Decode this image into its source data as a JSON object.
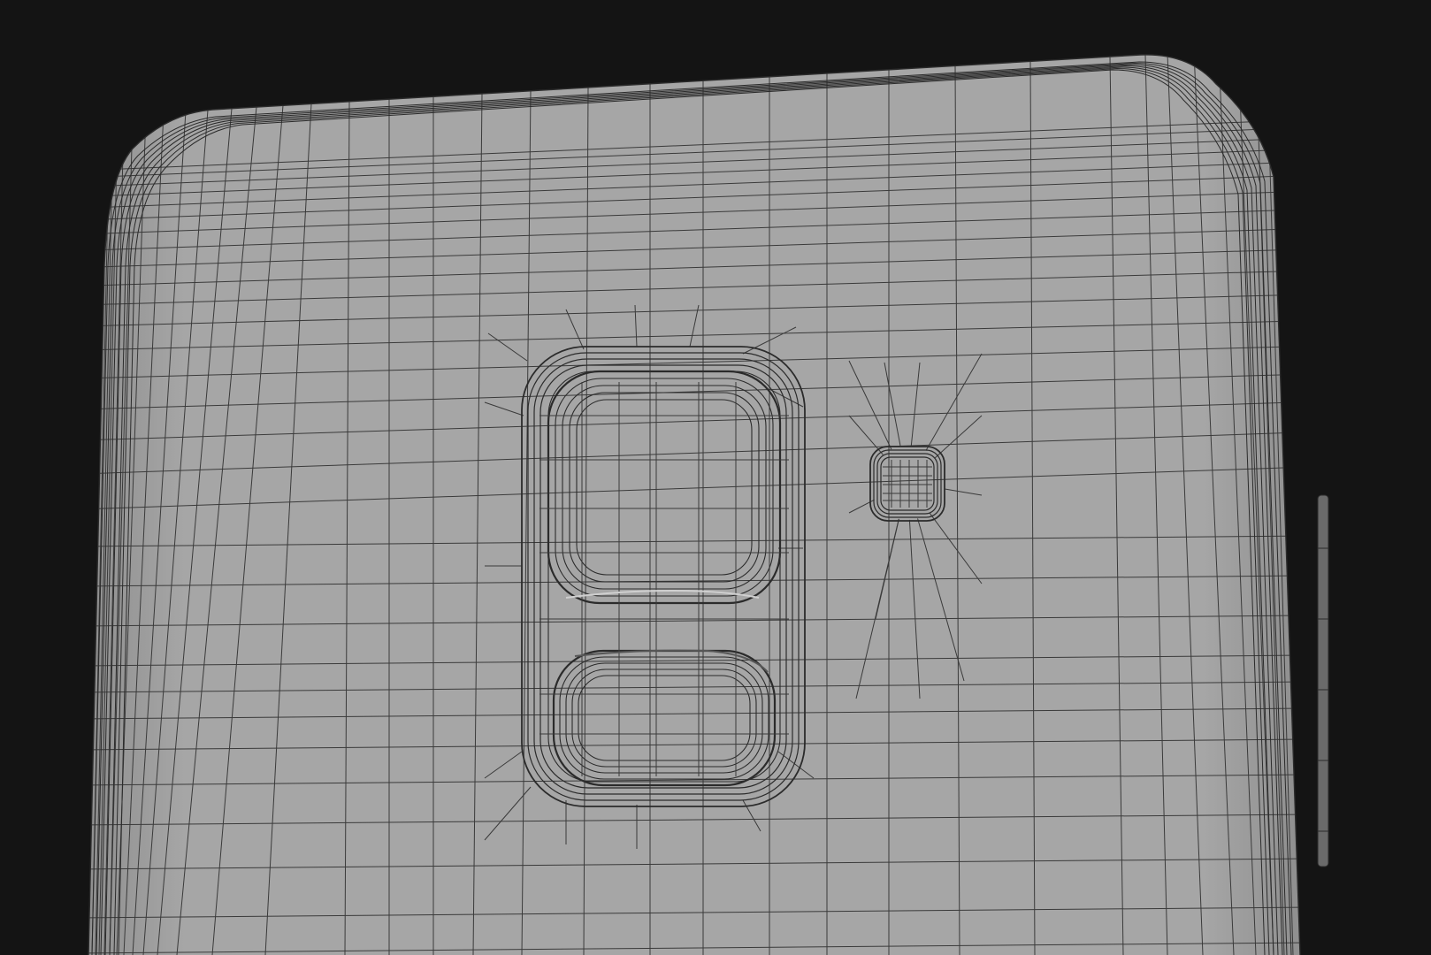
{
  "scene": {
    "subject": "wireframe-phone-back",
    "colors": {
      "background": "#141414",
      "body_fill": "#a6a6a6",
      "body_fill_edge": "#8f8f8f",
      "wire": "#3a3a3a",
      "wire_dense": "#2b2b2b",
      "bevel_light": "#cfcfcf",
      "bevel_dark": "#575757"
    }
  }
}
